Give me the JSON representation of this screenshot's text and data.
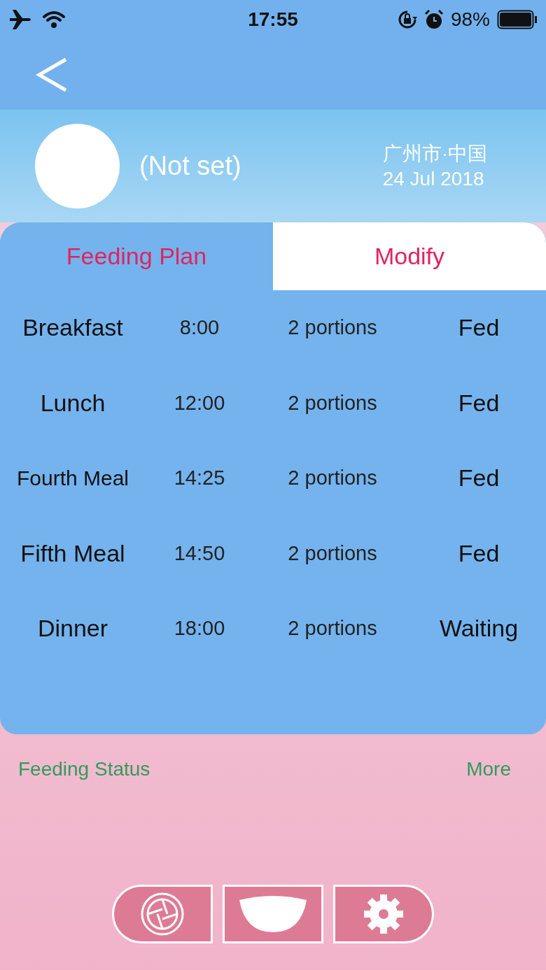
{
  "status_bar": {
    "time": "17:55",
    "battery": "98%"
  },
  "profile": {
    "name": "(Not set)",
    "location": "广州市·中国",
    "date": "24 Jul 2018"
  },
  "tabs": [
    {
      "label": "Feeding Plan",
      "selected": true
    },
    {
      "label": "Modify",
      "selected": false
    }
  ],
  "meals": [
    {
      "name": "Breakfast",
      "time": "8:00",
      "portions": "2 portions",
      "status": "Fed"
    },
    {
      "name": "Lunch",
      "time": "12:00",
      "portions": "2 portions",
      "status": "Fed"
    },
    {
      "name": "Fourth Meal",
      "time": "14:25",
      "portions": "2 portions",
      "status": "Fed"
    },
    {
      "name": "Fifth Meal",
      "time": "14:50",
      "portions": "2 portions",
      "status": "Fed"
    },
    {
      "name": "Dinner",
      "time": "18:00",
      "portions": "2 portions",
      "status": "Waiting"
    }
  ],
  "feeding_status": {
    "title": "Feeding Status",
    "more": "More"
  },
  "toolbar": [
    {
      "kind": "camera"
    },
    {
      "kind": "feed"
    },
    {
      "kind": "settings"
    }
  ]
}
